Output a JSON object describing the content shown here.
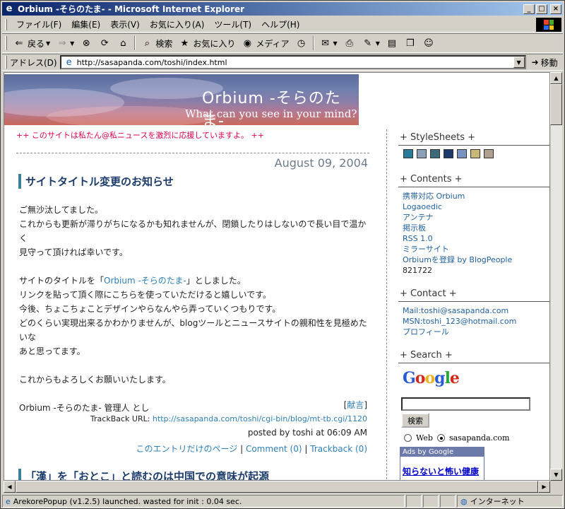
{
  "window": {
    "title": "Orbium -そらのたま- - Microsoft Internet Explorer",
    "minimize": "_",
    "maximize": "□",
    "close": "×"
  },
  "menu": [
    "ファイル(F)",
    "編集(E)",
    "表示(V)",
    "お気に入り(A)",
    "ツール(T)",
    "ヘルプ(H)"
  ],
  "toolbar": {
    "back": "戻る",
    "search": "検索",
    "favorites": "お気に入り",
    "media": "メディア"
  },
  "address": {
    "label": "アドレス(D)",
    "url": "http://sasapanda.com/toshi/index.html",
    "go": "移動"
  },
  "status": {
    "text": "ArekorePopup (v1.2.5) launched. wasted for init : 0.04 sec.",
    "zone": "インターネット"
  },
  "page": {
    "banner_title": "Orbium -そらのたま-",
    "banner_sub": "What can you see in your mind?",
    "notice": "++ このサイトは私たん@私ニュースを激烈に応援していますよ。 ++",
    "date": "August 09, 2004",
    "entry_title": "サイトタイトル変更のお知らせ",
    "body": {
      "p1_l1": "ご無沙汰してました。",
      "p1_l2": "これからも更新が滞りがちになるかも知れませんが、閉鎖したりはしないので長い目で温かく",
      "p1_l3": "見守って頂ければ幸いです。",
      "p2_pre": "サイトのタイトルを「",
      "p2_link": "Orbium -そらのたま-",
      "p2_post": "」としました。",
      "p2_l2": "リンクを貼って頂く際にこちらを使っていただけると嬉しいです。",
      "p2_l3": "今後、ちょこちょことデザインやらなんやら弄っていくつもりです。",
      "p2_l4": "どのくらい実現出来るかわかりませんが、blogツールとニュースサイトの親和性を見極めたいな",
      "p2_l5": "あと思ってます。",
      "p3": "これからもよろしくお願いいたします。",
      "p4": "Orbium -そらのたま- 管理人 とし"
    },
    "dedication_open": "[",
    "dedication": "献言",
    "dedication_close": "]",
    "trackback_label": "TrackBack URL:",
    "trackback_url": "http://sasapanda.com/toshi/cgi-bin/blog/mt-tb.cgi/1120",
    "posted": "posted by toshi at 06:09 AM",
    "entry_links": {
      "permalink": "このエントリだけのページ",
      "sep1": "|",
      "comment": "Comment (0)",
      "sep2": "|",
      "trackback": "Trackback (0)"
    },
    "next_title": "「漢」を「おとこ」と読むのは中国での意味が起源"
  },
  "sidebar": {
    "stylesheets_h": "+ StyleSheets +",
    "swatches": [
      "#2a7a98",
      "#8aa0b8",
      "#3c6a78",
      "#1b3a6a",
      "#7a92c0",
      "#c8b878",
      "#b0a090"
    ],
    "contents_h": "+ Contents +",
    "contents": [
      "携帯対応 Orbium",
      "Logaoedic",
      "アンテナ",
      "掲示板",
      "RSS 1.0",
      "ミラーサイト",
      "Orbiumを登録 by BlogPeople"
    ],
    "counter": "821722",
    "contact_h": "+ Contact +",
    "mail": "Mail:toshi@sasapanda.com",
    "msn": "MSN:toshi_123@hotmail.com",
    "profile": "プロフィール",
    "search_h": "+ Search +",
    "google": "Google",
    "search_btn": "検索",
    "radio_web": "Web",
    "radio_site": "sasapanda.com",
    "ads_head": "Ads by Google",
    "ads_link": "知らないと怖い健康"
  }
}
